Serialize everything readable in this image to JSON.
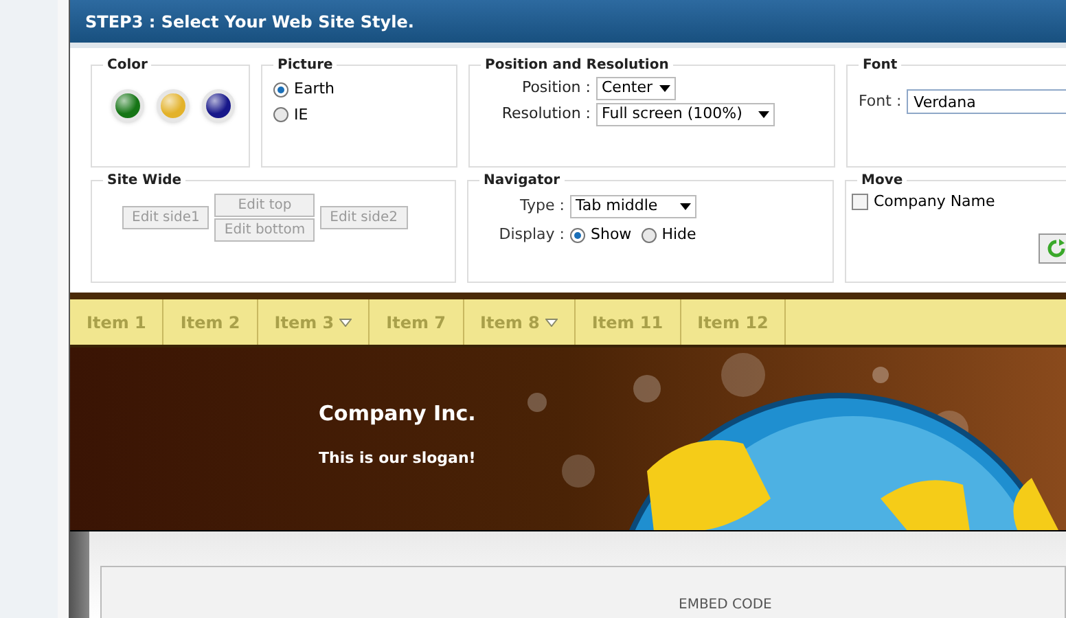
{
  "title": "STEP3 : Select Your Web Site Style.",
  "color": {
    "legend": "Color",
    "swatches": [
      {
        "color": "#157515"
      },
      {
        "color": "#e3b22a"
      },
      {
        "color": "#17178a"
      }
    ]
  },
  "picture": {
    "legend": "Picture",
    "options": [
      {
        "label": "Earth",
        "selected": true
      },
      {
        "label": "IE",
        "selected": false
      }
    ]
  },
  "position_resolution": {
    "legend": "Position and Resolution",
    "fields": [
      {
        "label": "Position :",
        "value": "Center"
      },
      {
        "label": "Resolution :",
        "value": "Full screen (100%)"
      }
    ]
  },
  "font": {
    "legend": "Font",
    "label": "Font :",
    "value": "Verdana"
  },
  "site_wide": {
    "legend": "Site Wide",
    "buttons": [
      {
        "label": "Edit side1",
        "disabled": true
      },
      {
        "label": "Edit top",
        "disabled": true
      },
      {
        "label": "Edit bottom",
        "disabled": true
      },
      {
        "label": "Edit side2",
        "disabled": true
      }
    ]
  },
  "navigator": {
    "legend": "Navigator",
    "type_label": "Type :",
    "type_value": "Tab middle",
    "display_label": "Display :",
    "display_options": [
      {
        "label": "Show",
        "selected": true
      },
      {
        "label": "Hide",
        "selected": false
      }
    ]
  },
  "move": {
    "legend": "Move",
    "checkbox": {
      "label": "Company Name",
      "checked": false
    }
  },
  "menu": [
    {
      "label": "Item 1",
      "has_submenu": false
    },
    {
      "label": "Item 2",
      "has_submenu": false
    },
    {
      "label": "Item 3",
      "has_submenu": true
    },
    {
      "label": "Item 7",
      "has_submenu": false
    },
    {
      "label": "Item 8",
      "has_submenu": true
    },
    {
      "label": "Item 11",
      "has_submenu": false
    },
    {
      "label": "Item 12",
      "has_submenu": false
    }
  ],
  "banner": {
    "company": "Company Inc.",
    "slogan": "This is our slogan!"
  },
  "embed": {
    "label": "EMBED CODE"
  }
}
